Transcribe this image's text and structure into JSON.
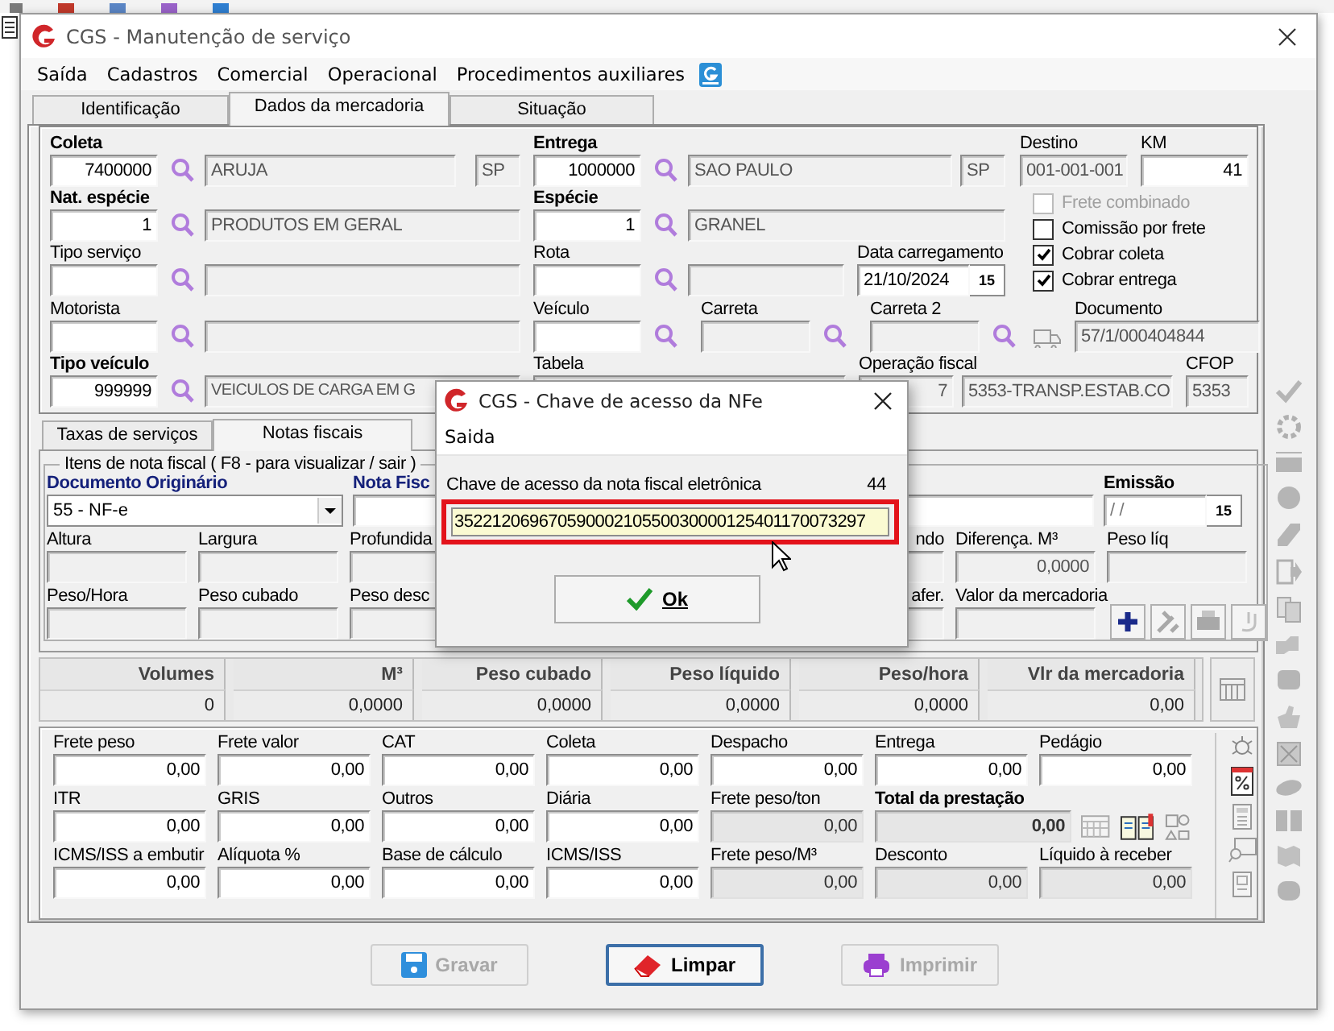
{
  "window": {
    "title": "CGS - Manutenção de serviço"
  },
  "menu": [
    "Saída",
    "Cadastros",
    "Comercial",
    "Operacional",
    "Procedimentos auxiliares"
  ],
  "tabs": [
    {
      "label": "Identificação",
      "selected": false
    },
    {
      "label": "Dados da mercadoria",
      "selected": true
    },
    {
      "label": "Situação",
      "selected": false
    }
  ],
  "header": {
    "coleta": {
      "label": "Coleta",
      "code": "7400000",
      "city": "ARUJA",
      "uf": "SP"
    },
    "entrega": {
      "label": "Entrega",
      "code": "1000000",
      "city": "SAO PAULO",
      "uf": "SP"
    },
    "destino": {
      "label": "Destino",
      "value": "001-001-001"
    },
    "km": {
      "label": "KM",
      "value": "41"
    },
    "nat_especie": {
      "label": "Nat. espécie",
      "code": "1",
      "description": "PRODUTOS EM GERAL"
    },
    "especie": {
      "label": "Espécie",
      "code": "1",
      "description": "GRANEL"
    },
    "tipo_servico": {
      "label": "Tipo serviço"
    },
    "rota": {
      "label": "Rota"
    },
    "data_carregamento": {
      "label": "Data carregamento",
      "value": "21/10/2024",
      "calendar": "15"
    },
    "motorista": {
      "label": "Motorista"
    },
    "veiculo": {
      "label": "Veículo"
    },
    "carreta": {
      "label": "Carreta"
    },
    "carreta_2": {
      "label": "Carreta 2"
    },
    "documento": {
      "label": "Documento",
      "value": "57/1/000404844"
    },
    "tipo_veiculo": {
      "label": "Tipo veículo",
      "code": "999999",
      "description": "VEICULOS DE CARGA EM G"
    },
    "tabela": {
      "label": "Tabela"
    },
    "operacao_fiscal": {
      "label": "Operação fiscal",
      "code": "7",
      "description": "5353-TRANSP.ESTAB.CO"
    },
    "cfop": {
      "label": "CFOP",
      "value": "5353"
    },
    "options": [
      {
        "label": "Frete combinado",
        "checked": false,
        "disabled": true
      },
      {
        "label": "Comissão por frete",
        "checked": false,
        "disabled": false
      },
      {
        "label": "Cobrar coleta",
        "checked": true,
        "disabled": false
      },
      {
        "label": "Cobrar entrega",
        "checked": true,
        "disabled": false
      }
    ]
  },
  "lower_tabs": [
    {
      "label": "Taxas de serviços",
      "selected": false
    },
    {
      "label": "Notas fiscais",
      "selected": true
    }
  ],
  "invoice_items": {
    "group_title": "Itens de nota fiscal ( F8 - para visualizar / sair )",
    "documento_originario": {
      "label": "Documento Originário",
      "value": "55 - NF-e"
    },
    "field_2": {
      "label": "Nota Fisc"
    },
    "emissao": {
      "label": "Emissão",
      "value": "/ /",
      "calendar": "15"
    },
    "altura": {
      "label": "Altura"
    },
    "largura": {
      "label": "Largura"
    },
    "field_3": {
      "label": "Profundida"
    },
    "field_6": {
      "label": "ndo"
    },
    "diferenca_m3": {
      "label": "Diferença. M³",
      "value": "0,0000"
    },
    "peso_liq": {
      "label": "Peso líq"
    },
    "peso_hora": {
      "label": "Peso/Hora"
    },
    "peso_cubado": {
      "label": "Peso cubado"
    },
    "field_3b": {
      "label": "Peso desc"
    },
    "field_6b": {
      "label": "afer."
    },
    "valor_mercadoria": {
      "label": "Valor da mercadoria"
    }
  },
  "totals": {
    "columns": [
      "Volumes",
      "M³",
      "Peso cubado",
      "Peso líquido",
      "Peso/hora",
      "Vlr da mercadoria"
    ],
    "values": [
      "0",
      "0,0000",
      "0,0000",
      "0,0000",
      "0,0000",
      "0,00"
    ]
  },
  "charges": {
    "rows": [
      [
        {
          "label": "Frete peso",
          "value": "0,00",
          "readonly": false
        },
        {
          "label": "Frete valor",
          "value": "0,00",
          "readonly": false
        },
        {
          "label": "CAT",
          "value": "0,00",
          "readonly": false
        },
        {
          "label": "Coleta",
          "value": "0,00",
          "readonly": false
        },
        {
          "label": "Despacho",
          "value": "0,00",
          "readonly": false
        },
        {
          "label": "Entrega",
          "value": "0,00",
          "readonly": false
        },
        {
          "label": "Pedágio",
          "value": "0,00",
          "readonly": false
        }
      ],
      [
        {
          "label": "ITR",
          "value": "0,00",
          "readonly": false
        },
        {
          "label": "GRIS",
          "value": "0,00",
          "readonly": false
        },
        {
          "label": "Outros",
          "value": "0,00",
          "readonly": false
        },
        {
          "label": "Diária",
          "value": "0,00",
          "readonly": false
        },
        {
          "label": "Frete peso/ton",
          "value": "0,00",
          "readonly": true
        }
      ],
      [
        {
          "label": "ICMS/ISS a embutir",
          "value": "0,00",
          "readonly": false
        },
        {
          "label": "Alíquota %",
          "value": "0,00",
          "readonly": false
        },
        {
          "label": "Base de cálculo",
          "value": "0,00",
          "readonly": false
        },
        {
          "label": "ICMS/ISS",
          "value": "0,00",
          "readonly": false
        },
        {
          "label": "Frete peso/M³",
          "value": "0,00",
          "readonly": true
        },
        {
          "label": "Desconto",
          "value": "0,00",
          "readonly": true
        },
        {
          "label": "Líquido à receber",
          "value": "0,00",
          "readonly": true
        }
      ]
    ],
    "total": {
      "label": "Total da prestação",
      "value": "0,00"
    }
  },
  "buttons": [
    {
      "label": "Gravar",
      "disabled": true,
      "focused": false
    },
    {
      "label": "Limpar",
      "disabled": false,
      "focused": true
    },
    {
      "label": "Imprimir",
      "disabled": true,
      "focused": false
    }
  ],
  "dialog": {
    "title": "CGS - Chave de acesso da NFe",
    "menu": [
      "Saida"
    ],
    "field_label": "Chave de acesso da nota fiscal eletrônica",
    "counter": "44",
    "value": "35221206967059000210550030000125401170073297",
    "highlighted": true,
    "ok_button": "Ok"
  }
}
